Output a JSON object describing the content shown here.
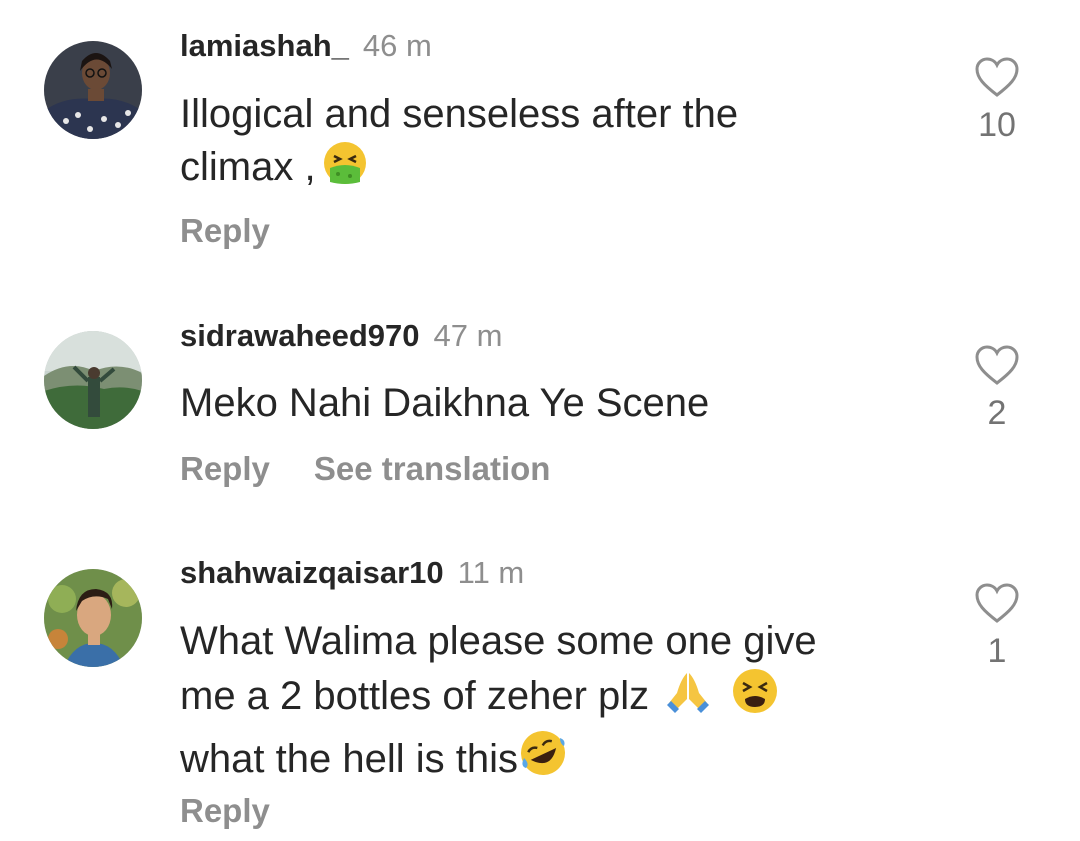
{
  "comments": [
    {
      "username": "lamiashah_",
      "time": "46 m",
      "text_line1": "Illogical and senseless after the",
      "text_line2": "climax ,",
      "emoji_after": "nauseated-face-emoji",
      "reply_label": "Reply",
      "likes": "10",
      "avatar": "woman-with-glasses-avatar"
    },
    {
      "username": "sidrawaheed970",
      "time": "47 m",
      "text_line1": "Meko Nahi Daikhna Ye Scene",
      "reply_label": "Reply",
      "translate_label": "See translation",
      "likes": "2",
      "avatar": "landscape-person-avatar"
    },
    {
      "username": "shahwaizqaisar10",
      "time": "11 m",
      "text_line1": "What Walima please some one give",
      "text_line2": "me a 2 bottles of zeher plz",
      "text_line3": "what the hell is this",
      "emojis": [
        "folded-hands-emoji",
        "tired-face-emoji",
        "rolling-laughing-emoji"
      ],
      "reply_label": "Reply",
      "likes": "1",
      "avatar": "young-man-avatar"
    }
  ],
  "icons": {
    "like": "heart-outline-icon"
  },
  "colors": {
    "text": "#262626",
    "secondary": "#8e8e8e",
    "count": "#737373"
  }
}
